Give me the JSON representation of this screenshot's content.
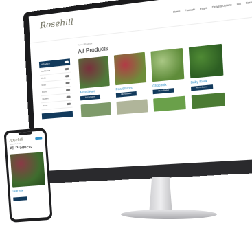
{
  "site": {
    "logo_text": "Rosehill",
    "logo_sub": "",
    "nav": [
      "Home",
      "Products",
      "Pages",
      "Delivery Options",
      "Gift",
      "Basket"
    ]
  },
  "sidebar": {
    "items": [
      {
        "label": "All Products"
      },
      {
        "label": "Leaf Salads"
      },
      {
        "label": "Herbs"
      },
      {
        "label": "Micro"
      },
      {
        "label": "Mixes"
      },
      {
        "label": "Flowers"
      },
      {
        "label": "Boxes"
      }
    ],
    "button_label": ""
  },
  "main": {
    "breadcrumb": "Home / Products",
    "page_title": "All Products",
    "cards": [
      {
        "title": "Mixed Kale",
        "desc": "",
        "button": "Add to Basket",
        "color_a": "#7a2f3d",
        "color_b": "#4f7a3a"
      },
      {
        "title": "Pea Shoots",
        "desc": "",
        "button": "Add to Basket",
        "color_a": "#b33a46",
        "color_b": "#6e8d3a"
      },
      {
        "title": "Chop Mix",
        "desc": "",
        "button": "Add to Basket",
        "color_a": "#a9c784",
        "color_b": "#5f8c3a"
      },
      {
        "title": "Baby Rock",
        "desc": "",
        "button": "Add to Basket",
        "color_a": "#4f8a34",
        "color_b": "#2d5e23"
      }
    ],
    "row2_colors": [
      "#7e9a6a",
      "#b0b59a",
      "#6aa04a",
      "#4b7b33"
    ]
  },
  "phone": {
    "logo_text": "Rosehill",
    "breadcrumb": "Home / Products",
    "page_title": "All Products",
    "card_title": "Leaf Mix",
    "desc": ""
  }
}
